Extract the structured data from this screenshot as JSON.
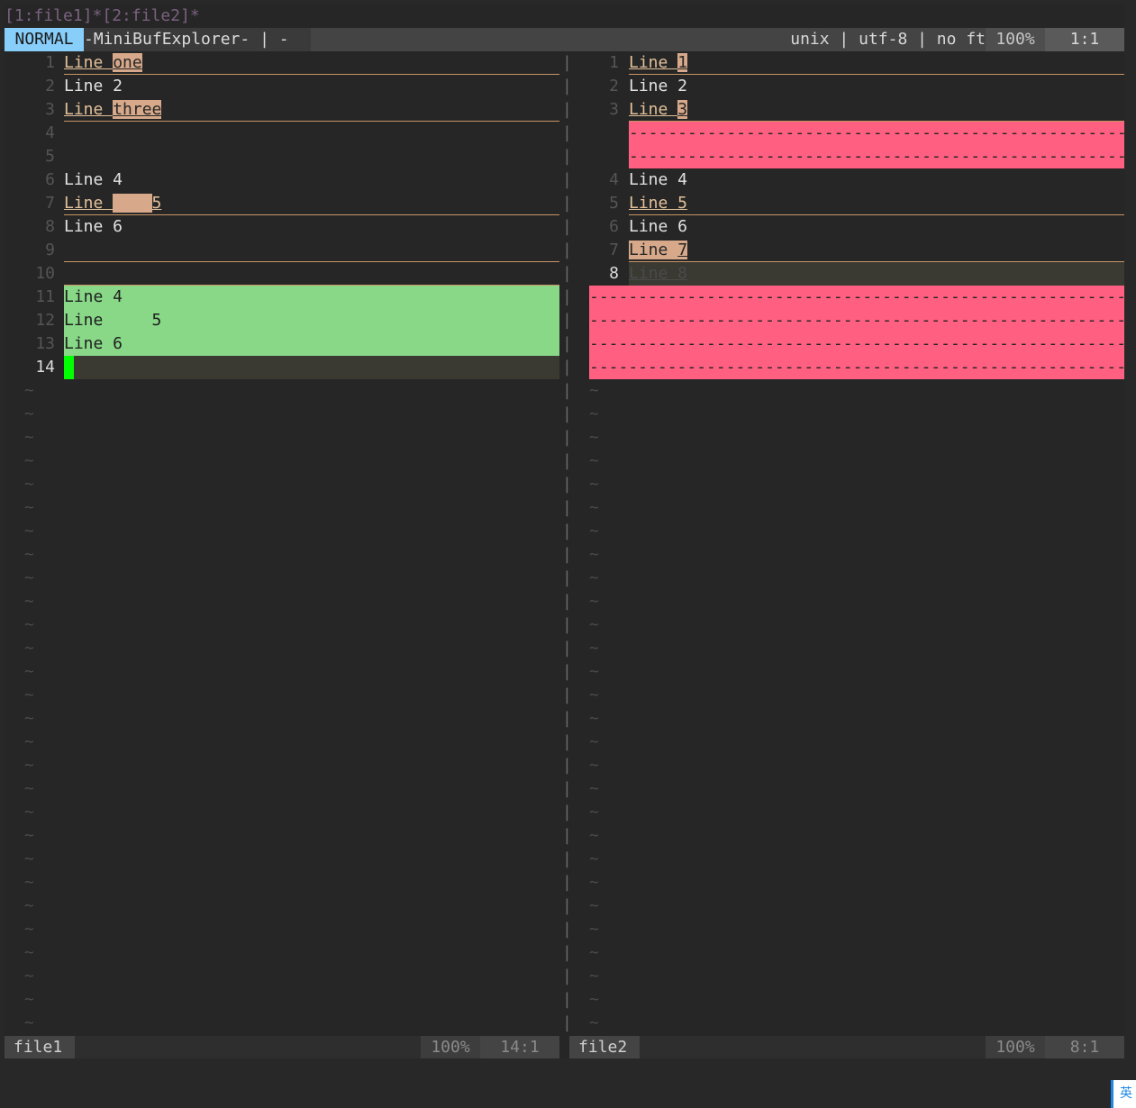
{
  "minibuf": "[1:file1]*[2:file2]*",
  "status": {
    "mode": "NORMAL",
    "title": "-MiniBufExplorer- | -",
    "format": "unix | utf-8 | no ft",
    "percent": "100%",
    "position": "1:1"
  },
  "left": {
    "l1": {
      "n": "1",
      "a": "Line ",
      "b": "one"
    },
    "l2": {
      "n": "2",
      "t": "Line 2"
    },
    "l3": {
      "n": "3",
      "a": "Line ",
      "b": "three"
    },
    "l4": {
      "n": "4"
    },
    "l5": {
      "n": "5"
    },
    "l6": {
      "n": "6",
      "t": "Line 4"
    },
    "l7": {
      "n": "7",
      "a": "Line ",
      "b": "    ",
      "c": "5"
    },
    "l8": {
      "n": "8",
      "t": "Line 6"
    },
    "l9": {
      "n": "9"
    },
    "l10": {
      "n": "10"
    },
    "l11": {
      "n": "11",
      "t": "Line 4"
    },
    "l12": {
      "n": "12",
      "t": "Line     5"
    },
    "l13": {
      "n": "13",
      "t": "Line 6"
    },
    "l14": {
      "n": "14"
    }
  },
  "right": {
    "l1": {
      "n": "1",
      "a": "Line ",
      "b": "1"
    },
    "l2": {
      "n": "2",
      "t": "Line 2"
    },
    "l3": {
      "n": "3",
      "a": "Line ",
      "b": "3"
    },
    "l4": {
      "n": "4",
      "t": "Line 4"
    },
    "l5": {
      "n": "5",
      "t": "Line 5"
    },
    "l6": {
      "n": "6",
      "t": "Line 6"
    },
    "l7": {
      "n": "7",
      "a": "Line ",
      "b": "7"
    },
    "l8": {
      "n": "8",
      "t": "Line 8"
    }
  },
  "filler": "--------------------------------------------------------",
  "divider_char": "|",
  "tilde": "~",
  "bottom": {
    "left": {
      "name": "file1",
      "percent": "100%",
      "position": "14:1"
    },
    "right": {
      "name": "file2",
      "percent": "100%",
      "position": "8:1"
    }
  },
  "ime": "英"
}
